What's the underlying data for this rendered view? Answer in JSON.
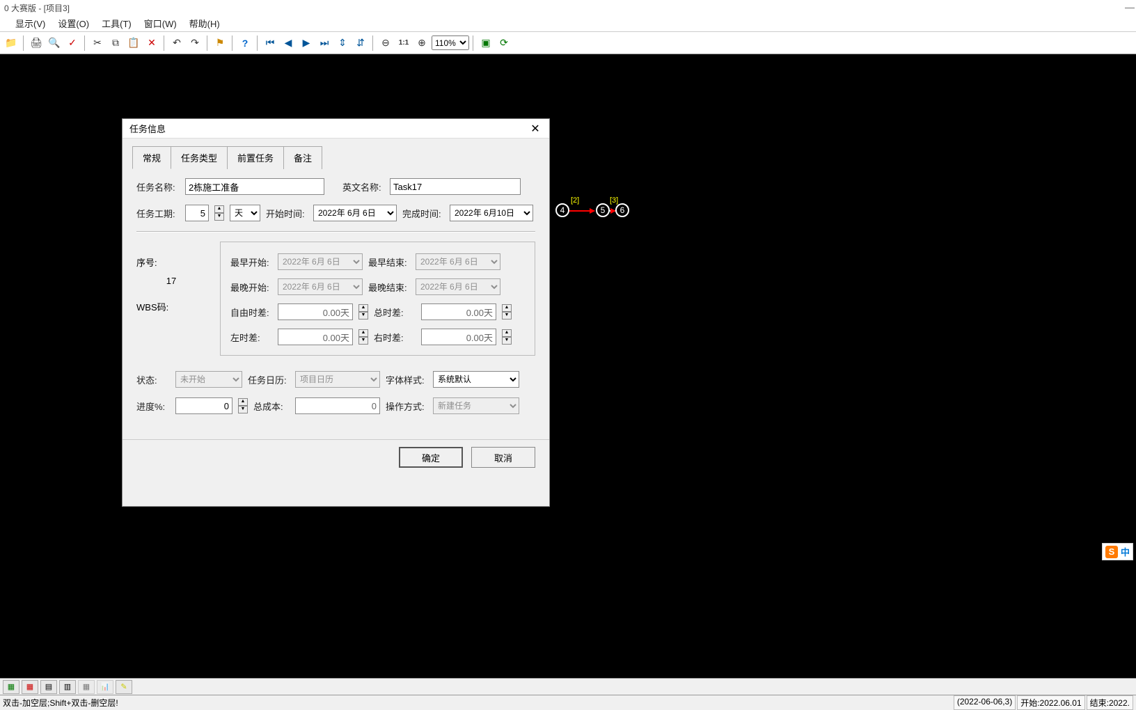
{
  "title": "0 大赛版 - [项目3]",
  "menu": [
    "",
    "显示(V)",
    "设置(O)",
    "工具(T)",
    "窗口(W)",
    "帮助(H)"
  ],
  "zoom": "110%",
  "dialog": {
    "title": "任务信息",
    "tabs": [
      "常规",
      "任务类型",
      "前置任务",
      "备注"
    ],
    "lbl_task_name": "任务名称:",
    "task_name": "2栋施工准备",
    "lbl_en_name": "英文名称:",
    "en_name": "Task17",
    "lbl_duration": "任务工期:",
    "duration": "5",
    "duration_unit": "天",
    "lbl_start": "开始时间:",
    "start": "2022年  6月  6日",
    "lbl_end": "完成时间:",
    "end": "2022年  6月10日",
    "lbl_seq": "序号:",
    "seq": "17",
    "lbl_wbs": "WBS码:",
    "lbl_es": "最早开始:",
    "es": "2022年  6月  6日",
    "lbl_ef": "最早结束:",
    "ef": "2022年  6月  6日",
    "lbl_ls": "最晚开始:",
    "ls": "2022年  6月  6日",
    "lbl_lf": "最晚结束:",
    "lf": "2022年  6月  6日",
    "lbl_ff": "自由时差:",
    "ff": "0.00天",
    "lbl_tf": "总时差:",
    "tf": "0.00天",
    "lbl_lslack": "左时差:",
    "lslack": "0.00天",
    "lbl_rslack": "右时差:",
    "rslack": "0.00天",
    "lbl_status": "状态:",
    "status": "未开始",
    "lbl_cal": "任务日历:",
    "cal": "项目日历",
    "lbl_font": "字体样式:",
    "font": "系统默认",
    "lbl_progress": "进度%:",
    "progress": "0",
    "lbl_cost": "总成本:",
    "cost": "0",
    "lbl_op": "操作方式:",
    "op": "新建任务",
    "ok": "确定",
    "cancel": "取消"
  },
  "nodes": {
    "n4": "4",
    "n5": "5",
    "n6": "6",
    "l2": "[2]",
    "l3": "[3]"
  },
  "status": {
    "left": "双击-加空层;Shift+双击-删空层!",
    "date": "(2022-06-06,3)",
    "start": "开始:2022.06.01",
    "end": "结束:2022."
  },
  "ime": {
    "s": "S",
    "c": "中"
  }
}
